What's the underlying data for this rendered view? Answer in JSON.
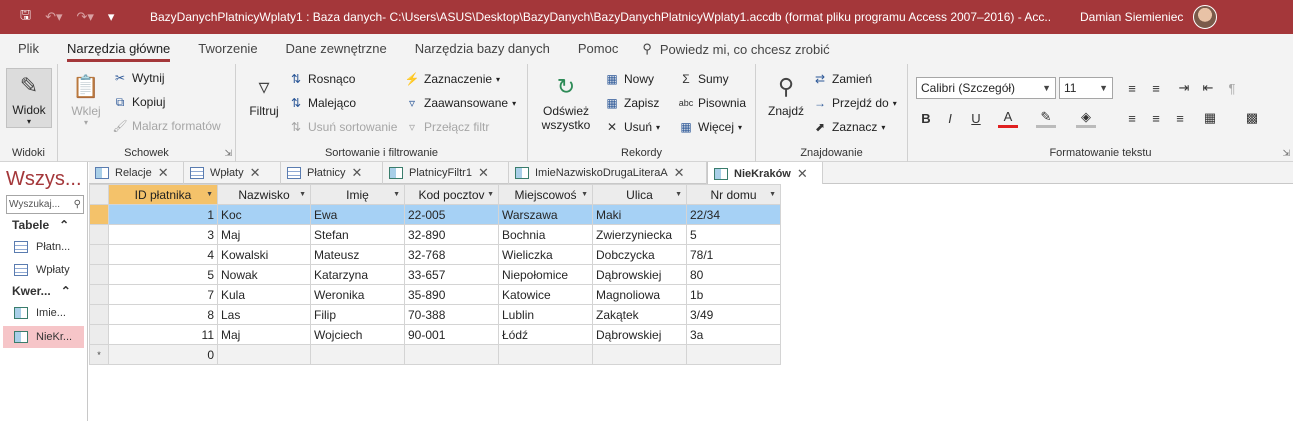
{
  "titlebar": {
    "quick_access": [
      "save-icon",
      "undo-icon",
      "redo-icon",
      "customize-icon"
    ],
    "title": "BazyDanychPlatnicyWplaty1 : Baza danych- C:\\Users\\ASUS\\Desktop\\BazyDanych\\BazyDanychPlatnicyWplaty1.accdb (format pliku programu Access 2007–2016)  - Acc...",
    "user_name": "Damian Siemieniec"
  },
  "ribbon_tabs": [
    "Plik",
    "Narzędzia główne",
    "Tworzenie",
    "Dane zewnętrzne",
    "Narzędzia bazy danych",
    "Pomoc"
  ],
  "tell_me": "Powiedz mi, co chcesz zrobić",
  "ribbon": {
    "widoki": {
      "label": "Widoki",
      "widok": "Widok"
    },
    "schowek": {
      "label": "Schowek",
      "wklej": "Wklej",
      "wytnij": "Wytnij",
      "kopiuj": "Kopiuj",
      "malarz": "Malarz formatów"
    },
    "sort": {
      "label": "Sortowanie i filtrowanie",
      "filtruj": "Filtruj",
      "rosnaco": "Rosnąco",
      "malejaco": "Malejąco",
      "usun_sort": "Usuń sortowanie",
      "zaznaczenie": "Zaznaczenie",
      "zaawansowane": "Zaawansowane",
      "przelacz": "Przełącz filtr"
    },
    "rekordy": {
      "label": "Rekordy",
      "odswiez1": "Odśwież",
      "odswiez2": "wszystko",
      "nowy": "Nowy",
      "zapisz": "Zapisz",
      "usun": "Usuń",
      "sumy": "Sumy",
      "pisownia": "Pisownia",
      "wiecej": "Więcej"
    },
    "znajdowanie": {
      "label": "Znajdowanie",
      "znajdz": "Znajdź",
      "zamien": "Zamień",
      "przejdz": "Przejdź do",
      "zaznacz": "Zaznacz"
    },
    "format": {
      "label": "Formatowanie tekstu",
      "font": "Calibri (Szczegół)",
      "size": "11",
      "bold": "B",
      "italic": "I",
      "underline": "U"
    }
  },
  "nav": {
    "title": "Wszys...",
    "search_placeholder": "Wyszukaj...",
    "tables_header": "Tabele",
    "tables": [
      "Płatn...",
      "Wpłaty"
    ],
    "queries_header": "Kwer...",
    "queries": [
      "Imie...",
      "NieKr..."
    ]
  },
  "doc_tabs": [
    "Relacje",
    "Wpłaty",
    "Płatnicy",
    "PlatnicyFiltr1",
    "ImieNazwiskoDrugaLiteraA",
    "NieKraków"
  ],
  "datasheet": {
    "columns": [
      "ID płatnika",
      "Nazwisko",
      "Imię",
      "Kod pocztov",
      "Miejscowoś",
      "Ulica",
      "Nr domu"
    ],
    "rows": [
      [
        "1",
        "Koc",
        "Ewa",
        "22-005",
        "Warszawa",
        "Maki",
        "22/34"
      ],
      [
        "3",
        "Maj",
        "Stefan",
        "32-890",
        "Bochnia",
        "Zwierzyniecka",
        "5"
      ],
      [
        "4",
        "Kowalski",
        "Mateusz",
        "32-768",
        "Wieliczka",
        "Dobczycka",
        "78/1"
      ],
      [
        "5",
        "Nowak",
        "Katarzyna",
        "33-657",
        "Niepołomice",
        "Dąbrowskiej",
        "80"
      ],
      [
        "7",
        "Kula",
        "Weronika",
        "35-890",
        "Katowice",
        "Magnoliowa",
        "1b"
      ],
      [
        "8",
        "Las",
        "Filip",
        "70-388",
        "Lublin",
        "Zakątek",
        "3/49"
      ],
      [
        "11",
        "Maj",
        "Wojciech",
        "90-001",
        "Łódź",
        "Dąbrowskiej",
        "3a"
      ]
    ],
    "new_row_marker": "*",
    "new_row_id": "0"
  },
  "colors": {
    "accent": "#a4373a",
    "selected_row": "#a6d1f5",
    "selector": "#f4c26a"
  }
}
